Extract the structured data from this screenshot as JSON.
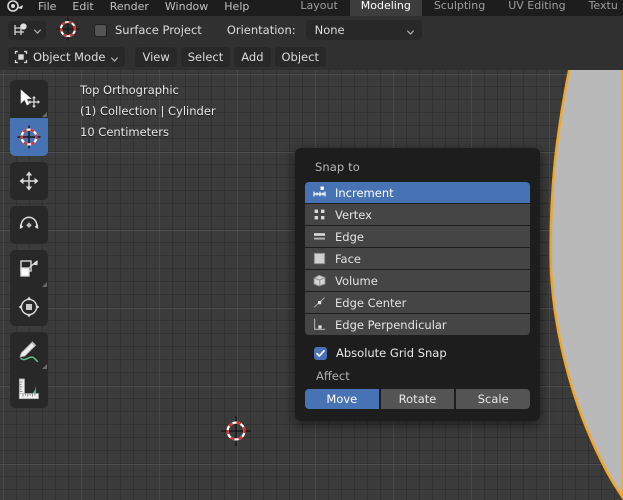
{
  "topbar": {
    "menus": [
      "File",
      "Edit",
      "Render",
      "Window",
      "Help"
    ],
    "logo_icon": "blender-logo-icon",
    "tabs": [
      {
        "label": "Layout",
        "active": false
      },
      {
        "label": "Modeling",
        "active": true
      },
      {
        "label": "Sculpting",
        "active": false
      },
      {
        "label": "UV Editing",
        "active": false
      },
      {
        "label": "Textu",
        "active": false
      }
    ]
  },
  "tool_settings": {
    "snap_magnet_icon": "snap-magnet-icon",
    "snap_dropdown_icon": "chevron-down-icon",
    "cursor_tool_icon": "3d-cursor-icon",
    "surface_project_label": "Surface Project",
    "surface_project_checked": false,
    "orientation_label": "Orientation:",
    "orientation_value": "None",
    "orientation_dropdown_icon": "chevron-down-icon"
  },
  "viewport_header": {
    "mode_icon": "object-mode-icon",
    "mode_label": "Object Mode",
    "mode_dropdown_icon": "chevron-down-icon",
    "menus": [
      "View",
      "Select",
      "Add",
      "Object"
    ]
  },
  "viewport": {
    "overlay_line1": "Top Orthographic",
    "overlay_line2": "(1) Collection | Cylinder",
    "overlay_line3": "10 Centimeters",
    "cursor_icon": "3d-cursor-icon",
    "object_name": "Cylinder",
    "background_color": "#3b3b3b",
    "selection_outline_color": "#f5a623",
    "object_fill_color": "#b9b9b9"
  },
  "toolbar": {
    "groups": [
      [
        {
          "name": "tweak-select-tool",
          "icon": "cursor-arrow-move-icon",
          "active": false,
          "has_submenu": true
        },
        {
          "name": "cursor-tool",
          "icon": "3d-cursor-icon",
          "active": true,
          "has_submenu": false
        }
      ],
      [
        {
          "name": "move-tool",
          "icon": "move-arrows-icon",
          "active": false,
          "has_submenu": false
        }
      ],
      [
        {
          "name": "rotate-tool",
          "icon": "rotate-icon",
          "active": false,
          "has_submenu": false
        }
      ],
      [
        {
          "name": "scale-tool",
          "icon": "scale-icon",
          "active": false,
          "has_submenu": true
        },
        {
          "name": "transform-tool",
          "icon": "transform-icon",
          "active": false,
          "has_submenu": false
        }
      ],
      [
        {
          "name": "annotate-tool",
          "icon": "pencil-annotate-icon",
          "active": false,
          "has_submenu": true
        },
        {
          "name": "measure-tool",
          "icon": "ruler-measure-icon",
          "active": false,
          "has_submenu": false
        }
      ]
    ]
  },
  "snap_panel": {
    "title": "Snap to",
    "options": [
      {
        "label": "Increment",
        "icon": "increment-icon",
        "selected": true
      },
      {
        "label": "Vertex",
        "icon": "vertex-icon",
        "selected": false
      },
      {
        "label": "Edge",
        "icon": "edge-icon",
        "selected": false
      },
      {
        "label": "Face",
        "icon": "face-icon",
        "selected": false
      },
      {
        "label": "Volume",
        "icon": "volume-icon",
        "selected": false
      },
      {
        "label": "Edge Center",
        "icon": "edge-center-icon",
        "selected": false
      },
      {
        "label": "Edge Perpendicular",
        "icon": "edge-perpendicular-icon",
        "selected": false
      }
    ],
    "absolute_grid_snap_label": "Absolute Grid Snap",
    "absolute_grid_snap_checked": true,
    "affect_label": "Affect",
    "affect_buttons": [
      {
        "label": "Move",
        "active": true
      },
      {
        "label": "Rotate",
        "active": false
      },
      {
        "label": "Scale",
        "active": false
      }
    ],
    "accent_color": "#4772b3",
    "panel_background": "#1d1d1d"
  }
}
